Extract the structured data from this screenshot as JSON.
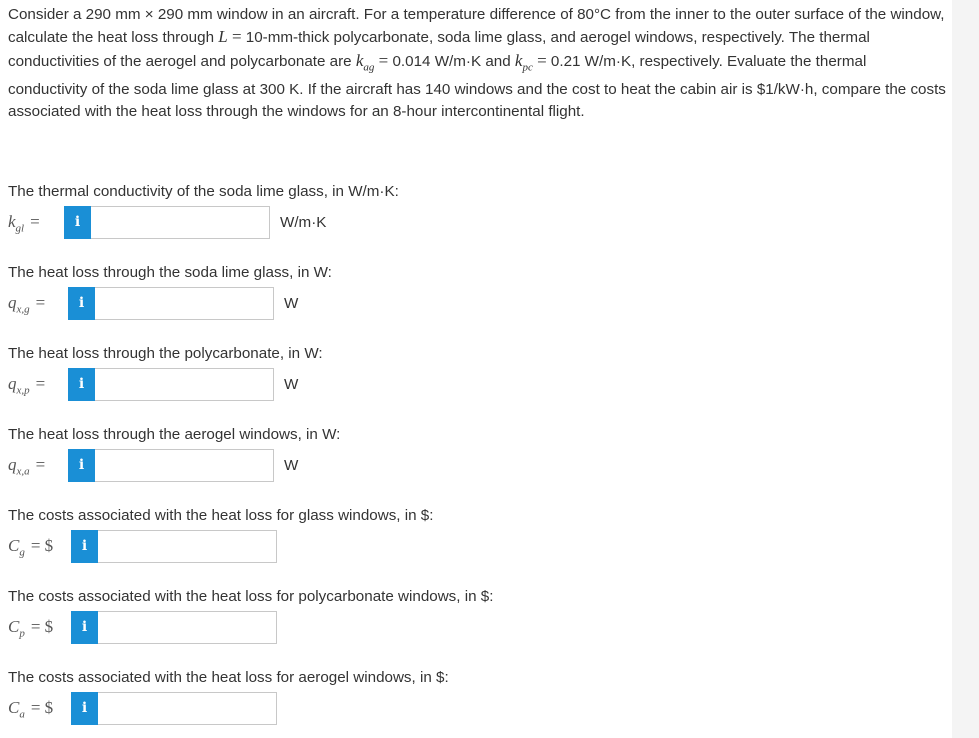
{
  "problem": {
    "part1": "Consider a 290 mm × 290 mm window in an aircraft. For a temperature difference of 80°C from the inner to the outer surface of the window, calculate the heat loss through",
    "L_symbol": "L",
    "L_eq": "=",
    "part2": "10-mm-thick polycarbonate, soda lime glass, and aerogel windows, respectively. The thermal conductivities of the aerogel and polycarbonate are",
    "kag_base": "k",
    "kag_sub": "ag",
    "kag_eq": "=",
    "part3": "0.014 W/m·K and",
    "kpc_base": "k",
    "kpc_sub": "pc",
    "kpc_eq": "=",
    "part4": "0.21 W/m·K, respectively. Evaluate the thermal conductivity of the soda lime glass at 300 K. If the aircraft has 140 windows and the cost to heat the cabin air is $1/kW·h, compare the costs associated with the heat loss through the windows for an 8-hour intercontinental flight."
  },
  "questions": [
    {
      "label": "The thermal conductivity of the soda lime glass, in W/m·K:",
      "sym_base": "k",
      "sym_sub": "gl",
      "eq": "=",
      "value": "",
      "unit": "W/m·K",
      "info": "i"
    },
    {
      "label": "The heat loss through the soda lime glass, in W:",
      "sym_base": "q",
      "sym_sub": "x,g",
      "eq": "=",
      "value": "",
      "unit": "W",
      "info": "i"
    },
    {
      "label": "The heat loss through the polycarbonate, in W:",
      "sym_base": "q",
      "sym_sub": "x,p",
      "eq": "=",
      "value": "",
      "unit": "W",
      "info": "i"
    },
    {
      "label": "The heat loss through the aerogel windows, in W:",
      "sym_base": "q",
      "sym_sub": "x,a",
      "eq": "=",
      "value": "",
      "unit": "W",
      "info": "i"
    },
    {
      "label": "The costs associated with the heat loss for glass windows, in $:",
      "sym_base": "C",
      "sym_sub": "g",
      "eq": "= $",
      "value": "",
      "unit": "",
      "info": "i"
    },
    {
      "label": "The costs associated with the heat loss for polycarbonate windows, in $:",
      "sym_base": "C",
      "sym_sub": "p",
      "eq": "= $",
      "value": "",
      "unit": "",
      "info": "i"
    },
    {
      "label": "The costs associated with the heat loss for aerogel windows, in $:",
      "sym_base": "C",
      "sym_sub": "a",
      "eq": "= $",
      "value": "",
      "unit": "",
      "info": "i"
    }
  ],
  "colors": {
    "info_button": "#1a8fd6",
    "text": "#333333",
    "input_border": "#c8c8c8"
  },
  "icons": {
    "info": "info-icon"
  }
}
